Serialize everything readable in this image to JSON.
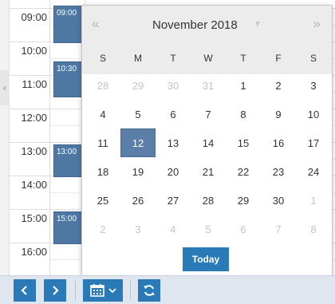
{
  "schedule": {
    "hours": [
      "09:00",
      "10:00",
      "11:00",
      "12:00",
      "13:00",
      "14:00",
      "15:00",
      "16:00"
    ],
    "events": [
      {
        "label": "09:00"
      },
      {
        "label": "10:30"
      },
      {
        "label": "13:00"
      },
      {
        "label": "15:00"
      }
    ]
  },
  "calendar": {
    "title": "November 2018",
    "prev_icon": "double-chevron-left-icon",
    "next_icon": "double-chevron-right-icon",
    "weekdays": [
      "S",
      "M",
      "T",
      "W",
      "T",
      "F",
      "S"
    ],
    "weeks": [
      [
        "28",
        "29",
        "30",
        "31",
        "1",
        "2",
        "3"
      ],
      [
        "4",
        "5",
        "6",
        "7",
        "8",
        "9",
        "10"
      ],
      [
        "11",
        "12",
        "13",
        "14",
        "15",
        "16",
        "17"
      ],
      [
        "18",
        "19",
        "20",
        "21",
        "22",
        "23",
        "24"
      ],
      [
        "25",
        "26",
        "27",
        "28",
        "29",
        "30",
        "1"
      ],
      [
        "2",
        "3",
        "4",
        "5",
        "6",
        "7",
        "8"
      ]
    ],
    "selected_day": "12",
    "today_label": "Today"
  },
  "toolbar": {
    "prev_icon": "chevron-left-icon",
    "next_icon": "chevron-right-icon",
    "calendar_icon": "calendar-icon",
    "refresh_icon": "refresh-icon",
    "accent": "#2a7ab8"
  }
}
